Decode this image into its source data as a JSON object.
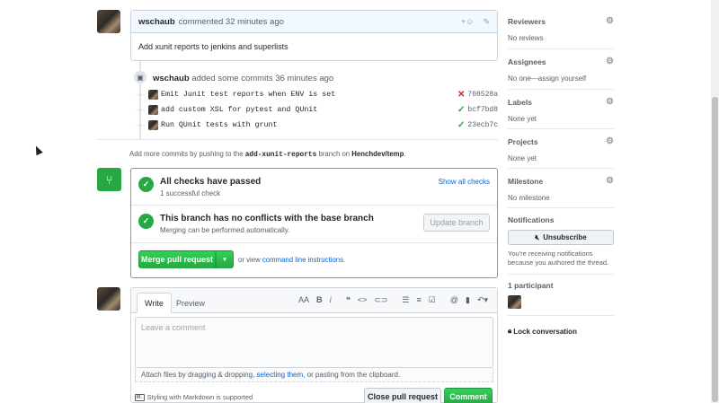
{
  "comment": {
    "author": "wschaub",
    "meta": "commented 32 minutes ago",
    "body": "Add xunit reports to jenkins and superlists",
    "reaction_icon": "smiley-icon",
    "edit_icon": "pencil-icon"
  },
  "commits_event": {
    "author": "wschaub",
    "meta": "added some commits 36 minutes ago",
    "commits": [
      {
        "message": "Emit Junit test reports when ENV is set",
        "status": "fail",
        "sha": "708528a"
      },
      {
        "message": "add custom XSL for pytest and QUnit",
        "status": "success",
        "sha": "bcf7bd8"
      },
      {
        "message": "Run QUnit tests with grunt",
        "status": "success",
        "sha": "23ecb7c"
      }
    ]
  },
  "push_hint": {
    "prefix": "Add more commits by pushing to the",
    "branch": "add-xunit-reports",
    "middle": "branch on",
    "repo": "Henchdev/temp",
    "suffix": "."
  },
  "merge": {
    "checks_title": "All checks have passed",
    "checks_sub": "1 successful check",
    "show_all": "Show all checks",
    "conflict_title": "This branch has no conflicts with the base branch",
    "conflict_sub": "Merging can be performed automatically.",
    "update_branch": "Update branch",
    "merge_button": "Merge pull request",
    "or_view": "or view",
    "cli_link": "command line instructions",
    "cli_suffix": "."
  },
  "editor": {
    "tab_write": "Write",
    "tab_preview": "Preview",
    "placeholder": "Leave a comment",
    "attach_prefix": "Attach files by dragging & dropping,",
    "attach_link": "selecting them",
    "attach_suffix": ", or pasting from the clipboard.",
    "markdown_note": "Styling with Markdown is supported",
    "close_button": "Close pull request",
    "comment_button": "Comment"
  },
  "sidebar": {
    "reviewers_title": "Reviewers",
    "reviewers_value": "No reviews",
    "assignees_title": "Assignees",
    "assignees_value": "No one—assign yourself",
    "labels_title": "Labels",
    "labels_value": "None yet",
    "projects_title": "Projects",
    "projects_value": "None yet",
    "milestone_title": "Milestone",
    "milestone_value": "No milestone",
    "notifications_title": "Notifications",
    "unsubscribe": "Unsubscribe",
    "notif_reason": "You're receiving notifications because you authored the thread.",
    "participants_title": "1 participant",
    "lock": "Lock conversation"
  },
  "colors": {
    "green": "#28a745",
    "blue_link": "#0366d6",
    "fail_red": "#cb2431"
  }
}
